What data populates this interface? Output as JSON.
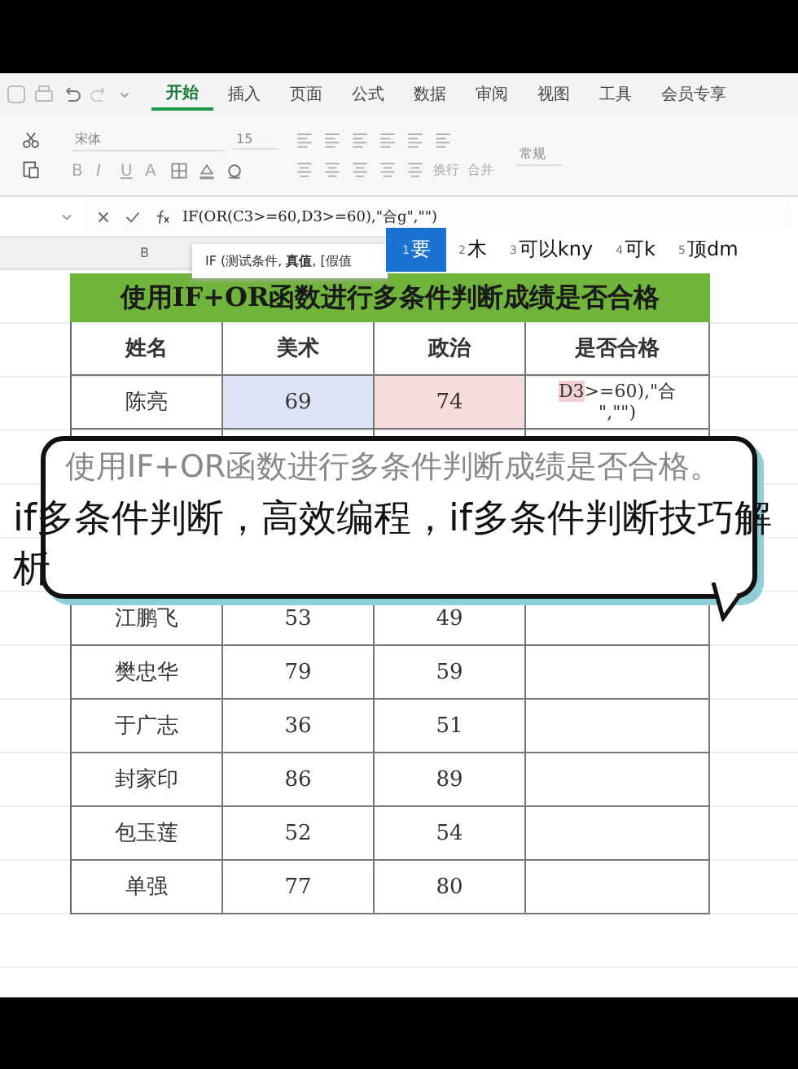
{
  "ribbon_tabs": [
    {
      "label": "开始",
      "selected": true
    },
    {
      "label": "插入",
      "selected": false
    },
    {
      "label": "页面",
      "selected": false
    },
    {
      "label": "公式",
      "selected": false
    },
    {
      "label": "数据",
      "selected": false
    },
    {
      "label": "审阅",
      "selected": false
    },
    {
      "label": "视图",
      "selected": false
    },
    {
      "label": "工具",
      "selected": false
    },
    {
      "label": "会员专享",
      "selected": false
    }
  ],
  "ribbon": {
    "font_name": "宋体",
    "font_size": "15",
    "format_buttons": [
      "B",
      "I",
      "U",
      "A"
    ],
    "wrap_label": "换行",
    "merge_label": "合并",
    "number_format": "常规"
  },
  "formula_bar": {
    "formula": "IF(OR(C3>=60,D3>=60),\"合g\",\"\")"
  },
  "column_header": "B",
  "function_tooltip": {
    "text": "IF  (测试条件, **真值**, [假值"
  },
  "ime_candidates": [
    {
      "index": "1",
      "text": "要",
      "selected": true
    },
    {
      "index": "2",
      "text": "木",
      "selected": false
    },
    {
      "index": "3",
      "text": "可以kny",
      "selected": false
    },
    {
      "index": "4",
      "text": "可k",
      "selected": false
    },
    {
      "index": "5",
      "text": "顶dm",
      "selected": false
    }
  ],
  "sheet": {
    "title": "使用IF+OR函数进行多条件判断成绩是否合格",
    "columns": [
      "姓名",
      "美术",
      "政治",
      "是否合格"
    ],
    "rows": [
      {
        "cells": [
          {
            "text": "陈亮"
          },
          {
            "text": "69",
            "color": "#dde3f4"
          },
          {
            "text": "74",
            "color": "#f7dcdc"
          },
          {
            "kind": "editing",
            "ref": "D3",
            "text": ">=60),\"合",
            "line2": "\",\"\")"
          }
        ]
      },
      {
        "cells": [
          {
            "text": "江鹏飞"
          },
          {
            "text": "53"
          },
          {
            "text": "49"
          },
          {
            "text": ""
          }
        ]
      },
      {
        "cells": [
          {
            "text": "樊忠华"
          },
          {
            "text": "79"
          },
          {
            "text": "59"
          },
          {
            "text": ""
          }
        ]
      },
      {
        "cells": [
          {
            "text": "于广志"
          },
          {
            "text": "36"
          },
          {
            "text": "51"
          },
          {
            "text": ""
          }
        ]
      },
      {
        "cells": [
          {
            "text": "封家印"
          },
          {
            "text": "86"
          },
          {
            "text": "89"
          },
          {
            "text": ""
          }
        ]
      },
      {
        "cells": [
          {
            "text": "包玉莲"
          },
          {
            "text": "52"
          },
          {
            "text": "54"
          },
          {
            "text": ""
          }
        ]
      },
      {
        "cells": [
          {
            "text": "单强"
          },
          {
            "text": "77"
          },
          {
            "text": "80"
          },
          {
            "text": ""
          }
        ]
      }
    ]
  },
  "bubble": {
    "text": "使用IF+OR函数进行多条件判断成绩是否合格。"
  },
  "caption": "if多条件判断，高效编程，if多条件判断技巧解析"
}
